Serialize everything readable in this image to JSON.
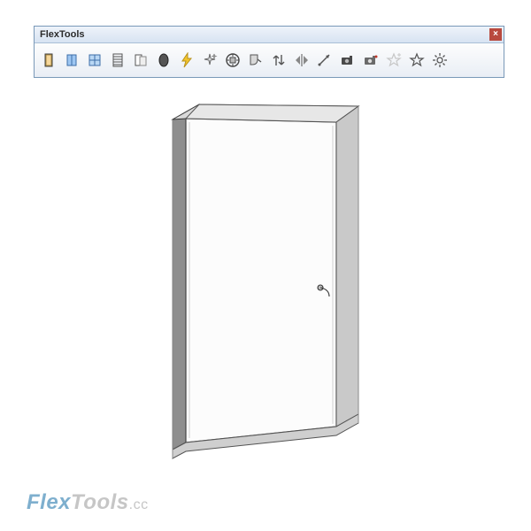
{
  "window": {
    "title": "FlexTools",
    "close_glyph": "×"
  },
  "toolbar": {
    "items": [
      {
        "name": "flexdoor",
        "label": "FlexDoor"
      },
      {
        "name": "flexwindow",
        "label": "FlexWindow"
      },
      {
        "name": "flexwindow-grid",
        "label": "FlexWindow Grid"
      },
      {
        "name": "flexslats",
        "label": "FlexSlats"
      },
      {
        "name": "flexsliding",
        "label": "FlexSliding"
      },
      {
        "name": "flexoval",
        "label": "FlexOval"
      },
      {
        "name": "zap",
        "label": "Convert to Dynamic"
      },
      {
        "name": "sparkle",
        "label": "Refresh"
      },
      {
        "name": "component-finder",
        "label": "ComponentFinder"
      },
      {
        "name": "wallcutter",
        "label": "WallCutter"
      },
      {
        "name": "elevation-arrows",
        "label": "Elevation Arrows"
      },
      {
        "name": "flip",
        "label": "Flip"
      },
      {
        "name": "extend",
        "label": "Extend"
      },
      {
        "name": "camera-1",
        "label": "Camera Tool"
      },
      {
        "name": "camera-2",
        "label": "Camera Tool Alt"
      },
      {
        "name": "favorite-add",
        "label": "Add Favorite"
      },
      {
        "name": "favorite",
        "label": "Favorites"
      },
      {
        "name": "settings",
        "label": "Settings"
      }
    ]
  },
  "logo": {
    "flex": "Flex",
    "tools": "Tools",
    "cc": ".cc"
  }
}
